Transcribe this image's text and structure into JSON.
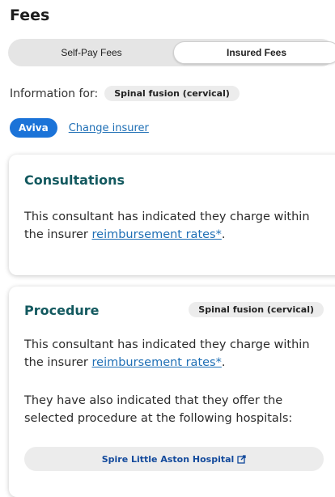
{
  "page": {
    "title": "Fees"
  },
  "toggle": {
    "self_pay_label": "Self-Pay Fees",
    "insured_label": "Insured Fees"
  },
  "info": {
    "label": "Information for:",
    "procedure_chip": "Spinal fusion (cervical)"
  },
  "insurer": {
    "name": "Aviva",
    "change_label": "Change insurer"
  },
  "consultations": {
    "title": "Consultations",
    "text_before": "This consultant has indicated they charge within the insurer ",
    "link": "reimbursement rates*",
    "text_after": "."
  },
  "procedure": {
    "title": "Procedure",
    "chip": "Spinal fusion (cervical)",
    "text_before": "This consultant has indicated they charge within the insurer ",
    "link": "reimbursement rates*",
    "text_after": ".",
    "hospitals_text": "They have also indicated that they offer the selected procedure at the following hospitals:",
    "hospitals": [
      "Spire Little Aston Hospital"
    ]
  },
  "colors": {
    "accent_teal": "#13595f",
    "link_blue": "#1f6fb5",
    "pill_blue": "#1b73d8"
  },
  "icons": {
    "external_link": "external-link-icon"
  }
}
